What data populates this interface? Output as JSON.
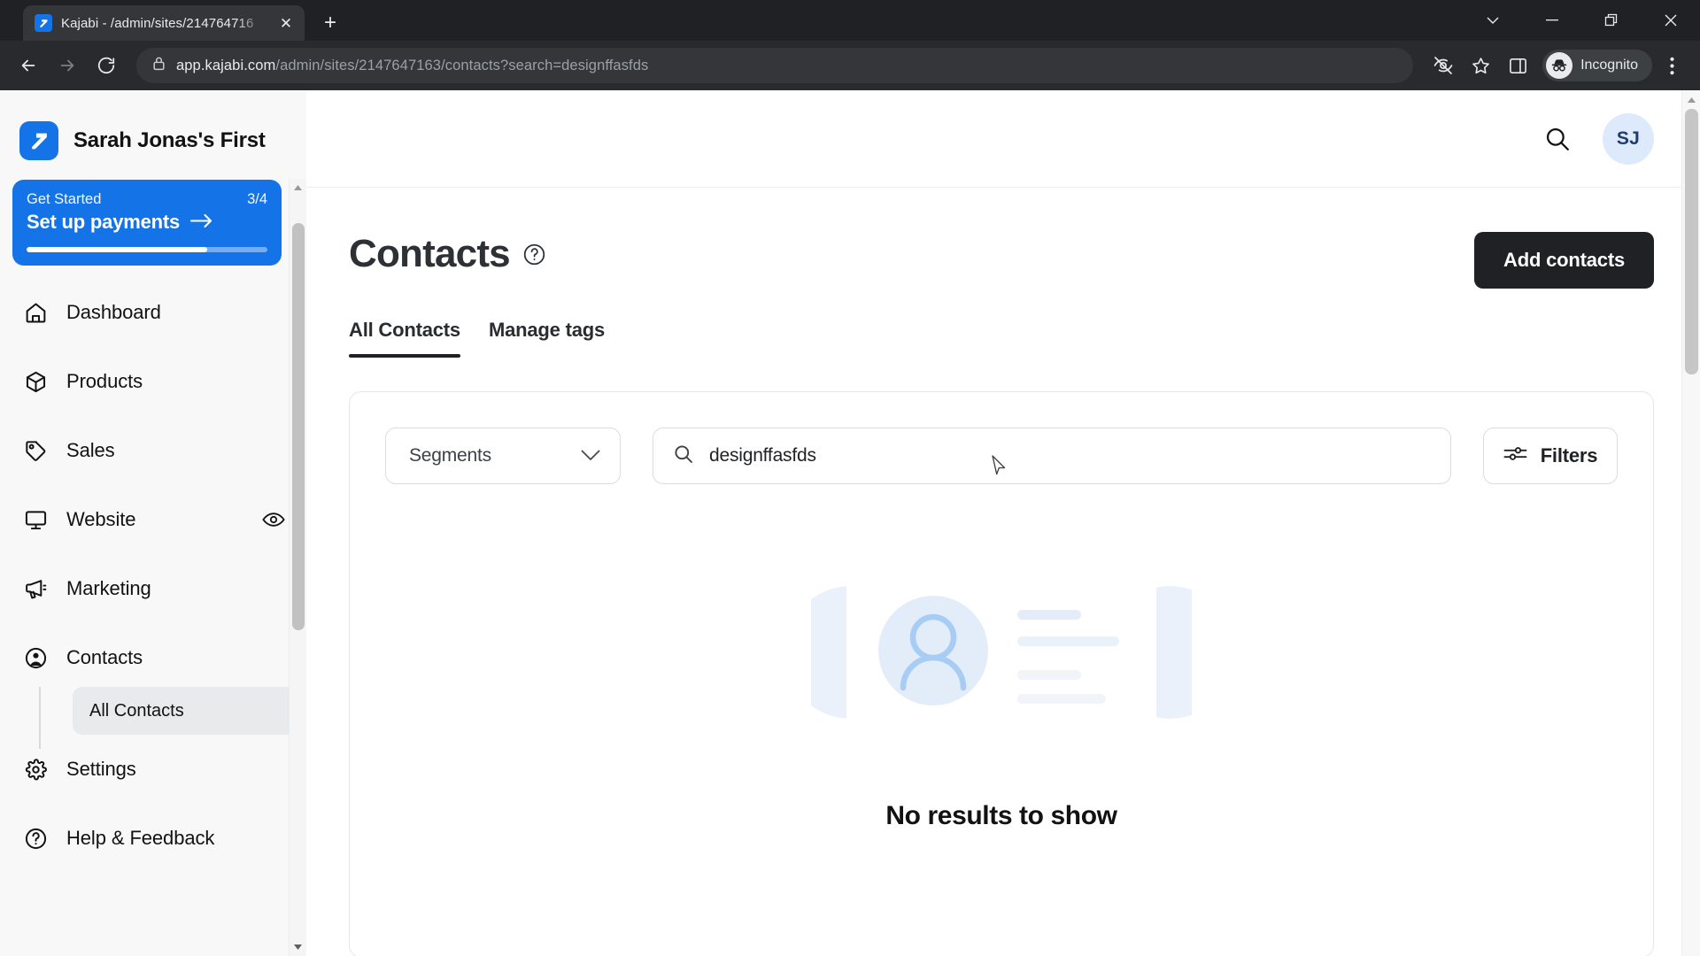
{
  "browser": {
    "tab": {
      "title": "Kajabi - /admin/sites/214764716",
      "favicon_name": "kajabi-favicon",
      "close_label": "✕"
    },
    "newtab_label": "+",
    "window_controls": [
      {
        "name": "tab-search-button",
        "glyph": "⌄"
      },
      {
        "name": "minimize-button",
        "glyph": "—"
      },
      {
        "name": "maximize-button",
        "glyph": "❐"
      },
      {
        "name": "close-window-button",
        "glyph": "✕"
      }
    ],
    "toolbar": {
      "back_label": "←",
      "forward_label": "→",
      "reload_label": "↻",
      "url_host": "app.kajabi.com",
      "url_path": "/admin/sites/2147647163/contacts?search=designffasfds",
      "incognito_label": "Incognito",
      "menu_label": "⋮"
    }
  },
  "sidebar": {
    "brand_name": "Sarah Jonas's First",
    "get_started": {
      "label": "Get Started",
      "count": "3/4",
      "title": "Set up payments",
      "arrow": "→",
      "progress_percent": 75
    },
    "items": [
      {
        "label": "Dashboard",
        "icon": "home-icon",
        "trailing": null
      },
      {
        "label": "Products",
        "icon": "box-icon",
        "trailing": null
      },
      {
        "label": "Sales",
        "icon": "tag-icon",
        "trailing": null
      },
      {
        "label": "Website",
        "icon": "monitor-icon",
        "trailing": "eye-icon"
      },
      {
        "label": "Marketing",
        "icon": "megaphone-icon",
        "trailing": null
      },
      {
        "label": "Contacts",
        "icon": "contact-icon",
        "trailing": null
      }
    ],
    "sub_items": [
      {
        "label": "All Contacts",
        "active": true
      }
    ],
    "bottom_items": [
      {
        "label": "Settings",
        "icon": "gear-icon"
      },
      {
        "label": "Help & Feedback",
        "icon": "help-circle-icon"
      }
    ]
  },
  "topbar": {
    "search_icon": "search-icon",
    "avatar_initials": "SJ"
  },
  "main": {
    "page_title": "Contacts",
    "help_icon": "help-circle-icon",
    "add_contacts_label": "Add contacts",
    "tabs": [
      {
        "label": "All Contacts",
        "active": true
      },
      {
        "label": "Manage tags",
        "active": false
      }
    ],
    "filters": {
      "segments_label": "Segments",
      "search_value": "designffasfds",
      "search_placeholder": "Search",
      "filters_label": "Filters"
    },
    "empty_state": {
      "message": "No results to show",
      "illustration": "no-contacts-illustration"
    }
  },
  "colors": {
    "brand_blue": "#1473e6",
    "dark": "#1f2124",
    "sidebar_bg": "#f8f8f8",
    "avatar_bg": "#ddeafc",
    "avatar_text": "#1f3d70"
  }
}
